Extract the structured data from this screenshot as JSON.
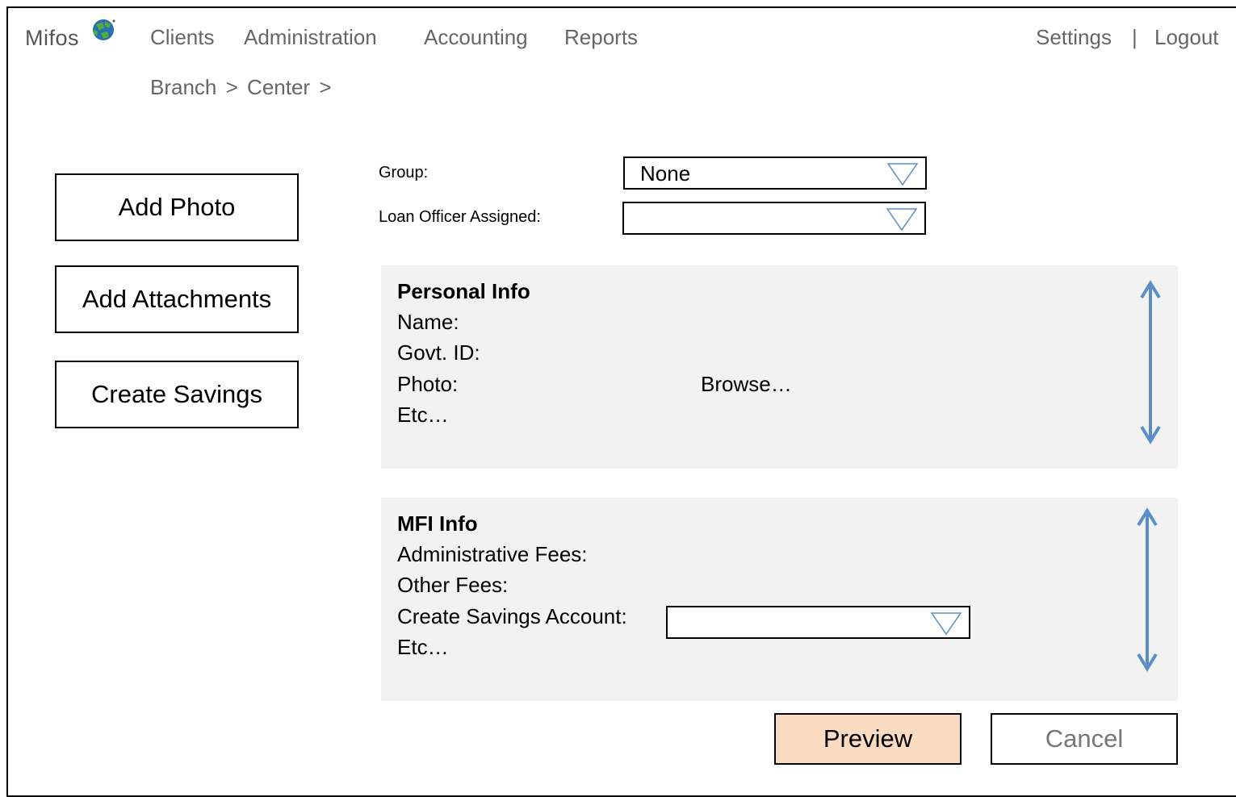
{
  "app": {
    "logo_text": "Mifos",
    "colors": {
      "logo_blue": "#2a6fb0",
      "logo_green": "#4fae3a",
      "arrow_blue": "#5b8ec9",
      "panel_bg": "#f2f2f2",
      "preview_bg": "#fbdcc2"
    }
  },
  "nav": {
    "items": [
      "Clients",
      "Administration",
      "Accounting",
      "Reports"
    ],
    "settings": "Settings",
    "separator": "|",
    "logout": "Logout"
  },
  "breadcrumb": {
    "items": [
      "Branch",
      "Center"
    ],
    "separator": ">"
  },
  "actions": {
    "add_photo": "Add Photo",
    "add_attachments": "Add Attachments",
    "create_savings": "Create Savings"
  },
  "form": {
    "group_label": "Group:",
    "group_value": "None",
    "loan_officer_label": "Loan Officer Assigned:",
    "loan_officer_value": ""
  },
  "personal_info": {
    "heading": "Personal Info",
    "name_label": "Name:",
    "govt_id_label": "Govt. ID:",
    "photo_label": "Photo:",
    "browse_label": "Browse…",
    "etc": "Etc…"
  },
  "mfi_info": {
    "heading": "MFI Info",
    "admin_fees_label": "Administrative Fees:",
    "other_fees_label": "Other Fees:",
    "savings_account_label": "Create Savings Account:",
    "savings_account_value": "",
    "etc": "Etc…"
  },
  "footer": {
    "preview": "Preview",
    "cancel": "Cancel"
  },
  "icons": {
    "logo": "globe-logo-icon",
    "dropdown": "triangle-down-icon",
    "scroll": "double-arrow-vertical-icon"
  }
}
